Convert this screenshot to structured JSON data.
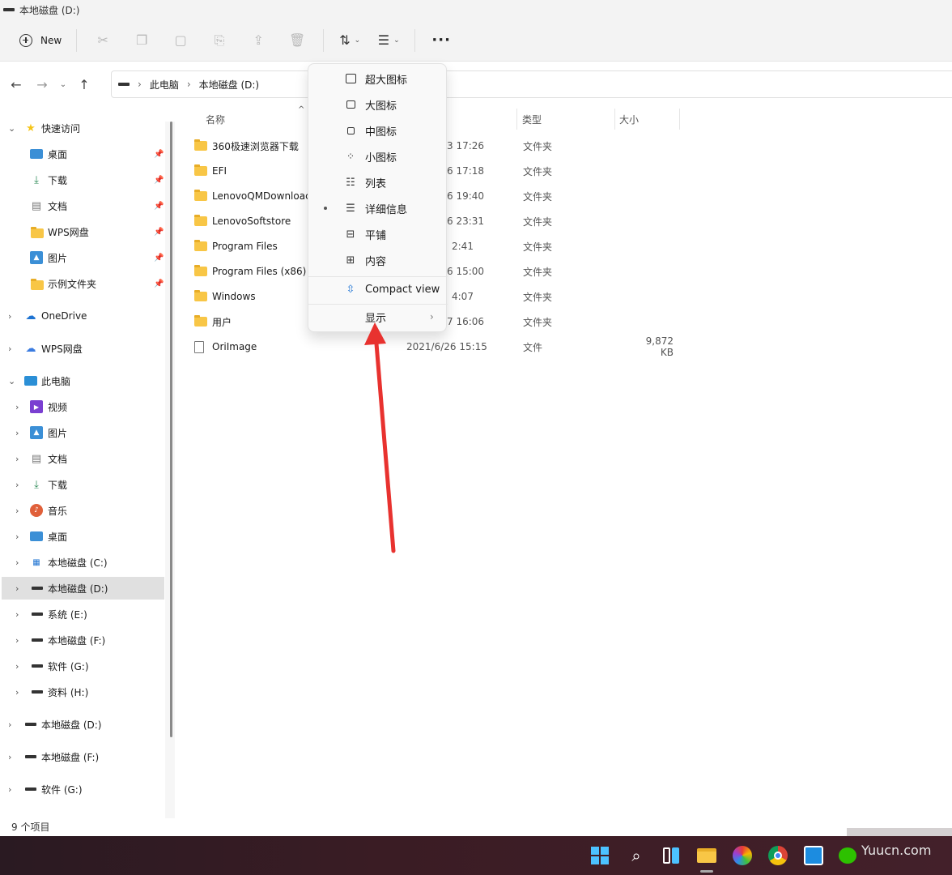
{
  "window": {
    "title": "本地磁盘 (D:)"
  },
  "toolbar": {
    "new_label": "New",
    "icons": [
      "cut-icon",
      "copy-icon",
      "paste-icon",
      "rename-icon",
      "share-icon",
      "delete-icon",
      "sort-icon",
      "view-icon",
      "more-icon"
    ]
  },
  "address": {
    "crumbs": [
      "此电脑",
      "本地磁盘 (D:)"
    ]
  },
  "sidebar": {
    "quick_access": "快速访问",
    "quick_items": [
      "桌面",
      "下载",
      "文档",
      "WPS网盘",
      "图片",
      "示例文件夹"
    ],
    "onedrive": "OneDrive",
    "wps": "WPS网盘",
    "this_pc": "此电脑",
    "pc_items": [
      "视频",
      "图片",
      "文档",
      "下载",
      "音乐",
      "桌面",
      "本地磁盘 (C:)",
      "本地磁盘 (D:)",
      "系统 (E:)",
      "本地磁盘 (F:)",
      "软件 (G:)",
      "资料 (H:)"
    ],
    "drives": [
      "本地磁盘 (D:)",
      "本地磁盘 (F:)",
      "软件 (G:)"
    ]
  },
  "columns": {
    "name": "名称",
    "type": "类型",
    "size": "大小"
  },
  "files": [
    {
      "name": "360极速浏览器下载",
      "date": "3 17:26",
      "type": "文件夹",
      "size": "",
      "kind": "folder"
    },
    {
      "name": "EFI",
      "date": "6 17:18",
      "type": "文件夹",
      "size": "",
      "kind": "folder"
    },
    {
      "name": "LenovoQMDownloac",
      "date": "6 19:40",
      "type": "文件夹",
      "size": "",
      "kind": "folder"
    },
    {
      "name": "LenovoSoftstore",
      "date": "6 23:31",
      "type": "文件夹",
      "size": "",
      "kind": "folder"
    },
    {
      "name": "Program Files",
      "date": "2:41",
      "type": "文件夹",
      "size": "",
      "kind": "folder"
    },
    {
      "name": "Program Files (x86)",
      "date": "6 15:00",
      "type": "文件夹",
      "size": "",
      "kind": "folder"
    },
    {
      "name": "Windows",
      "date": "4:07",
      "type": "文件夹",
      "size": "",
      "kind": "folder"
    },
    {
      "name": "用户",
      "date": "7 16:06",
      "type": "文件夹",
      "size": "",
      "kind": "folder"
    },
    {
      "name": "OriImage",
      "date": "2021/6/26 15:15",
      "type": "文件",
      "size": "9,872 KB",
      "kind": "file"
    }
  ],
  "view_menu": {
    "items": [
      "超大图标",
      "大图标",
      "中图标",
      "小图标",
      "列表",
      "详细信息",
      "平铺",
      "内容"
    ],
    "selected": "详细信息",
    "compact": "Compact view",
    "show": "显示"
  },
  "status": {
    "count": "9 个项目"
  },
  "watermark": "Yuucn.com",
  "annotation_color": "#e8322f"
}
